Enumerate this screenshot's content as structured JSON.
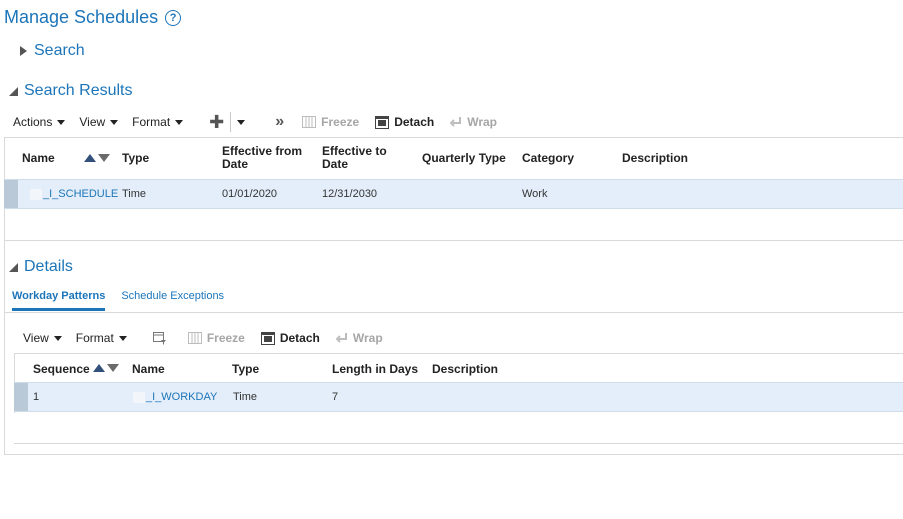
{
  "page": {
    "title": "Manage Schedules",
    "help_icon": "?"
  },
  "search": {
    "label": "Search"
  },
  "search_results": {
    "label": "Search Results",
    "toolbar": {
      "actions": "Actions",
      "view": "View",
      "format": "Format",
      "more": "»",
      "freeze": "Freeze",
      "detach": "Detach",
      "wrap": "Wrap"
    },
    "columns": [
      "Name",
      "Type",
      "Effective from Date",
      "Effective to Date",
      "Quarterly Type",
      "Category",
      "Description"
    ],
    "columns_split": {
      "name": "Name",
      "type": "Type",
      "eff_from_1": "Effective from",
      "eff_from_2": "Date",
      "eff_to_1": "Effective to",
      "eff_to_2": "Date",
      "quarterly": "Quarterly Type",
      "category": "Category",
      "description": "Description"
    },
    "rows": [
      {
        "name": "_I_SCHEDULE",
        "type": "Time",
        "eff_from": "01/01/2020",
        "eff_to": "12/31/2030",
        "quarterly": "",
        "category": "Work",
        "description": ""
      }
    ]
  },
  "details": {
    "label": "Details",
    "tabs": [
      {
        "label": "Workday Patterns",
        "active": true
      },
      {
        "label": "Schedule Exceptions",
        "active": false
      }
    ],
    "toolbar": {
      "view": "View",
      "format": "Format",
      "freeze": "Freeze",
      "detach": "Detach",
      "wrap": "Wrap"
    },
    "columns": {
      "sequence": "Sequence",
      "name": "Name",
      "type": "Type",
      "length": "Length in Days",
      "description": "Description"
    },
    "rows": [
      {
        "sequence": "1",
        "name": "_I_WORKDAY",
        "type": "Time",
        "length": "7",
        "description": ""
      }
    ]
  },
  "colors": {
    "accent": "#1c75b9",
    "row_selected": "#e3eefa",
    "disabled": "#a6a6a6"
  }
}
